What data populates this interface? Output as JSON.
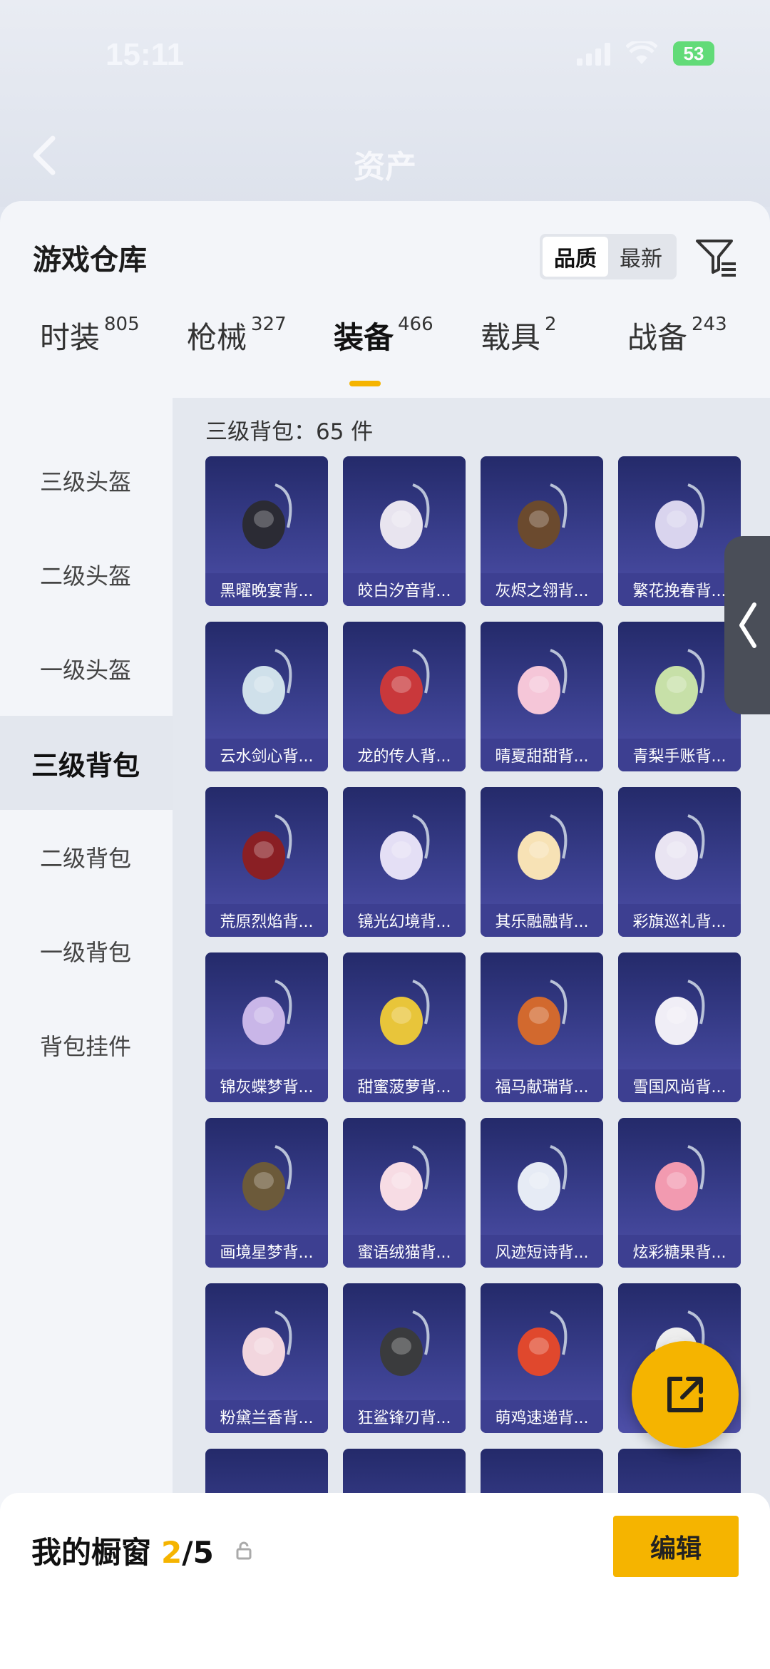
{
  "status_bar": {
    "time": "15:11",
    "battery": "53"
  },
  "background_header": {
    "title": "资产"
  },
  "panel": {
    "title": "游戏仓库",
    "sort_options": [
      "品质",
      "最新"
    ],
    "sort_selected": "品质"
  },
  "tabs": [
    {
      "label": "时装",
      "count": "805"
    },
    {
      "label": "枪械",
      "count": "327"
    },
    {
      "label": "装备",
      "count": "466"
    },
    {
      "label": "载具",
      "count": "2"
    },
    {
      "label": "战备",
      "count": "243"
    }
  ],
  "active_tab": "装备",
  "sidebar": {
    "items": [
      "三级头盔",
      "二级头盔",
      "一级头盔",
      "三级背包",
      "二级背包",
      "一级背包",
      "背包挂件"
    ],
    "active": "三级背包"
  },
  "grid": {
    "heading": "三级背包：65 件",
    "items": [
      "黑曜晚宴背...",
      "皎白汐音背...",
      "灰烬之翎背...",
      "繁花挽春背...",
      "云水剑心背...",
      "龙的传人背...",
      "晴夏甜甜背...",
      "青梨手账背...",
      "荒原烈焰背...",
      "镜光幻境背...",
      "其乐融融背...",
      "彩旗巡礼背...",
      "锦灰蝶梦背...",
      "甜蜜菠萝背...",
      "福马献瑞背...",
      "雪国风尚背...",
      "画境星梦背...",
      "蜜语绒猫背...",
      "风迹短诗背...",
      "炫彩糖果背...",
      "粉黛兰香背...",
      "狂鲨锋刃背...",
      "萌鸡速递背...",
      ""
    ]
  },
  "showcase": {
    "label": "我的橱窗",
    "current": "2",
    "total": "/5"
  },
  "edit_button": "编辑",
  "colors": {
    "accent": "#f5b400",
    "card_bg": "#3a3f8e"
  }
}
